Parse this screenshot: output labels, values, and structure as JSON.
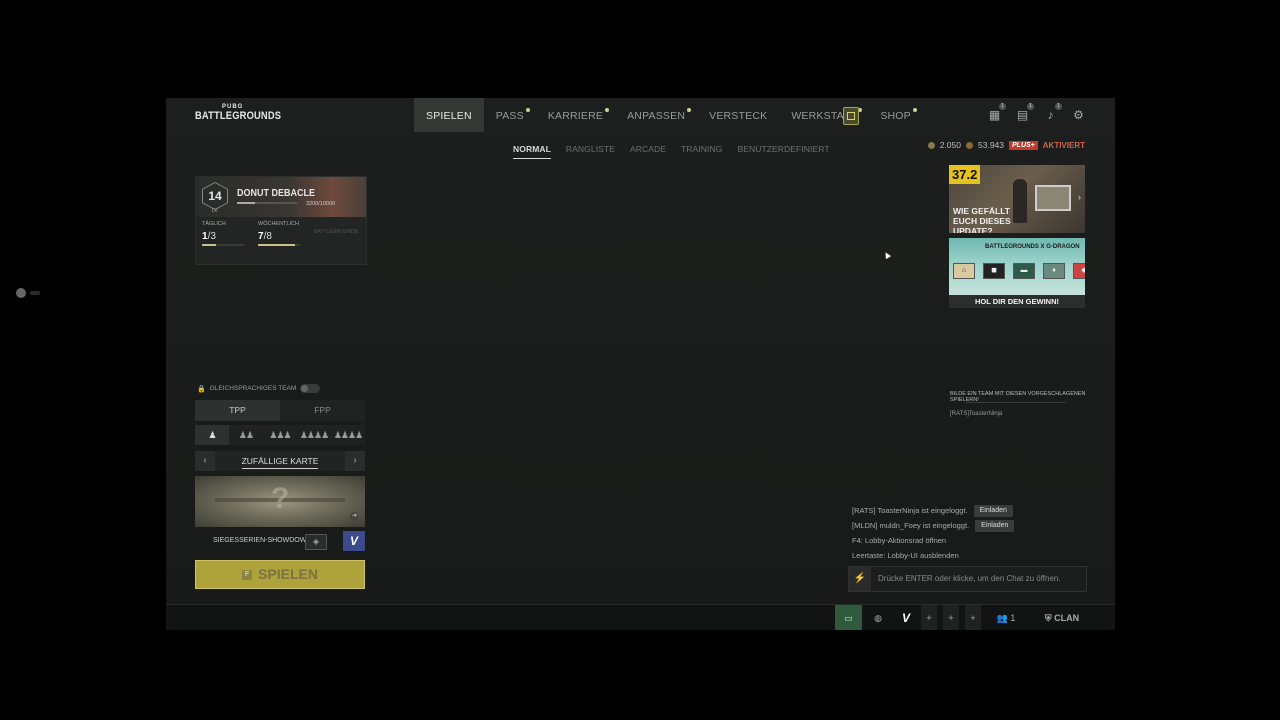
{
  "logo": {
    "small": "PUBG",
    "big": "BATTLEGROUNDS"
  },
  "nav": [
    {
      "label": "SPIELEN",
      "active": true,
      "dot": false
    },
    {
      "label": "PASS",
      "active": false,
      "dot": true
    },
    {
      "label": "KARRIERE",
      "active": false,
      "dot": true
    },
    {
      "label": "ANPASSEN",
      "active": false,
      "dot": true
    },
    {
      "label": "VERSTECK",
      "active": false,
      "dot": false
    },
    {
      "label": "WERKSTATT",
      "active": false,
      "dot": true
    },
    {
      "label": "SHOP",
      "active": false,
      "dot": true
    }
  ],
  "subnav": [
    {
      "label": "NORMAL",
      "active": true
    },
    {
      "label": "RANGLISTE",
      "active": false
    },
    {
      "label": "ARCADE",
      "active": false
    },
    {
      "label": "TRAINING",
      "active": false
    },
    {
      "label": "BENUTZERDEFINIERT",
      "active": false
    }
  ],
  "currency": {
    "bp": "2.050",
    "gcoin": "53.943",
    "plus": "PLUS+",
    "status": "AKTIVIERT"
  },
  "top_icons": [
    "inventory-icon",
    "mail-icon",
    "bell-icon",
    "settings-icon"
  ],
  "banners": {
    "update": {
      "version": "37.2",
      "text": "WIE GEFÄLLT EUCH DIESES UPDATE?"
    },
    "collab": {
      "logo": "BATTLEGROUNDS X G-DRAGON",
      "text": "HOL DIR DEN GEWINN!"
    }
  },
  "player": {
    "level": "14",
    "lv": "LV",
    "name": "DONUT DEBACLE",
    "xp": "3200/10000",
    "daily_label": "TÄGLICH",
    "daily_done": "1",
    "daily_total": "/3",
    "daily_progress": 0.33,
    "weekly_label": "WÖCHENTLICH",
    "weekly_done": "7",
    "weekly_total": "/8",
    "weekly_progress": 0.875,
    "third_label": "BATTLEGROUNDS"
  },
  "matchmaking": {
    "same_lang": "GLEICHSPRACHIGES TEAM",
    "modes": [
      {
        "label": "TPP",
        "active": true
      },
      {
        "label": "FPP",
        "active": false
      }
    ],
    "squads": [
      "♟",
      "♟♟",
      "♟♟♟",
      "♟♟♟♟",
      "♟♟♟♟"
    ],
    "map_label": "ZUFÄLLIGE KARTE",
    "event_label": "SIEGESSERIEN-SHOWDOWN",
    "play_label": "SPIELEN",
    "play_key": "F"
  },
  "suggest": {
    "title": "BILDE EIN TEAM MIT DIESEN VORGESCHLAGENEN SPIELERN!",
    "player": "[RATS]ToasterNinja"
  },
  "chat": {
    "lines": [
      {
        "text": "[RATS] ToasterNinja ist eingeloggt.",
        "button": "Einladen"
      },
      {
        "text": "[MLDN] muldn_Foey ist eingeloggt.",
        "button": "Einladen"
      },
      {
        "text": "F4: Lobby-Aktionsrad öffnen",
        "button": null
      },
      {
        "text": "Leertaste: Lobby-UI ausblenden",
        "button": null
      }
    ],
    "placeholder": "Drücke ENTER oder klicke, um den Chat zu öffnen."
  },
  "bottom": {
    "friends_count": "1",
    "clan_label": "CLAN"
  }
}
